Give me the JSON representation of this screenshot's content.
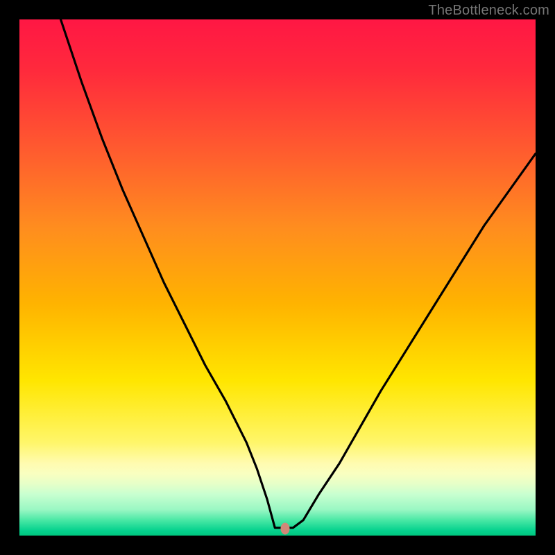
{
  "watermark": "TheBottleneck.com",
  "colors": {
    "frame": "#000000",
    "curve": "#000000",
    "marker": "#d08878",
    "gradient_top": "#ff1744",
    "gradient_mid": "#ffe600",
    "gradient_bottom": "#00c77f"
  },
  "chart_data": {
    "type": "line",
    "title": "",
    "xlabel": "",
    "ylabel": "",
    "xlim": [
      0,
      100
    ],
    "ylim": [
      0,
      100
    ],
    "grid": false,
    "legend": false,
    "annotations": [],
    "series": [
      {
        "name": "curve",
        "x": [
          8,
          12,
          16,
          20,
          24,
          28,
          32,
          36,
          40,
          44,
          46,
          48,
          49.5,
          51.5,
          53,
          55,
          58,
          62,
          66,
          70,
          75,
          80,
          85,
          90,
          95,
          100
        ],
        "y": [
          100,
          88,
          77,
          67,
          58,
          49,
          41,
          33,
          26,
          18,
          13,
          7,
          1.5,
          1.5,
          1.5,
          3,
          8,
          14,
          21,
          28,
          36,
          44,
          52,
          60,
          67,
          74
        ]
      }
    ],
    "marker": {
      "x": 51.5,
      "y": 1.4
    },
    "notes": "Values are read off the plot in percent of the 744x744 drawing area; y measured from bottom, x measured from left. Curve is a bottleneck-style V with minimum near x≈51.5%."
  }
}
